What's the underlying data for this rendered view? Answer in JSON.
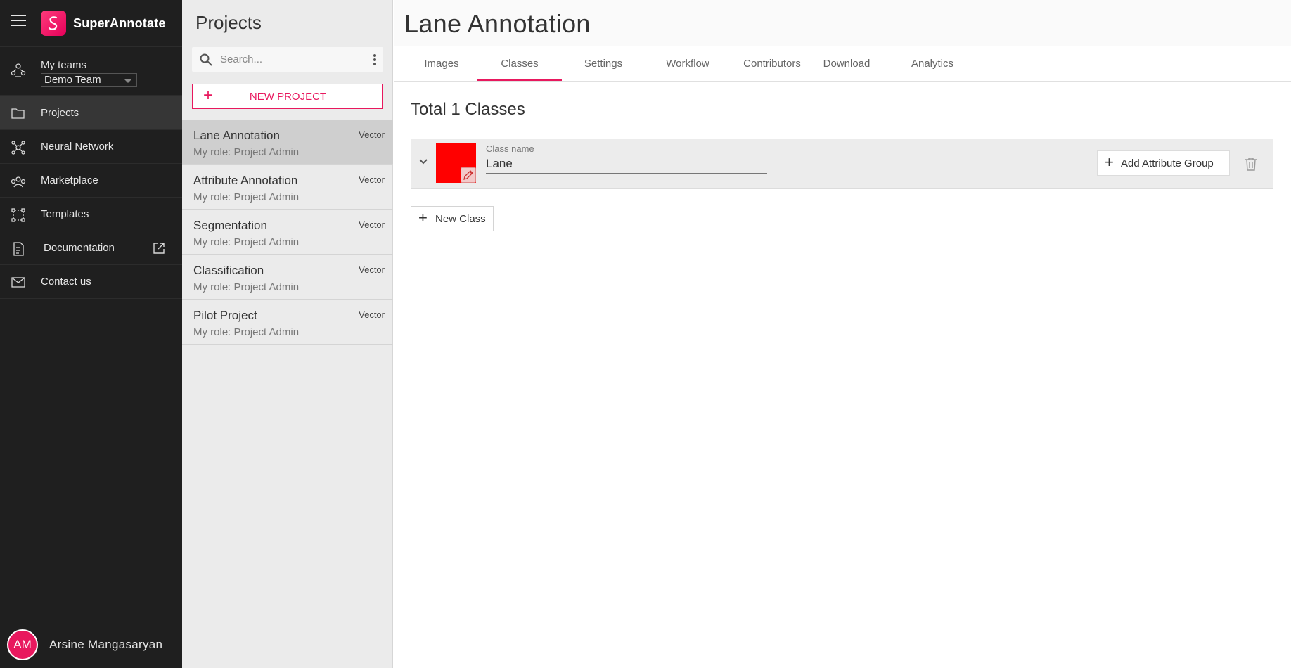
{
  "app": {
    "brand": "SuperAnnotate",
    "accent_color": "#e8185e"
  },
  "sidebar": {
    "teams_label": "My teams",
    "team_selected": "Demo Team",
    "items": [
      {
        "label": "Projects",
        "icon": "folder-icon",
        "active": true
      },
      {
        "label": "Neural Network",
        "icon": "neural-network-icon"
      },
      {
        "label": "Marketplace",
        "icon": "marketplace-icon"
      },
      {
        "label": "Templates",
        "icon": "templates-icon"
      },
      {
        "label": "Documentation",
        "icon": "document-icon"
      },
      {
        "label": "Contact us",
        "icon": "mail-icon"
      }
    ],
    "user": {
      "initials": "AM",
      "name": "Arsine Mangasaryan"
    }
  },
  "projects": {
    "title": "Projects",
    "search_placeholder": "Search...",
    "new_button": "NEW PROJECT",
    "list": [
      {
        "name": "Lane Annotation",
        "type": "Vector",
        "role": "My role: Project Admin",
        "active": true
      },
      {
        "name": "Attribute Annotation",
        "type": "Vector",
        "role": "My role: Project Admin"
      },
      {
        "name": "Segmentation",
        "type": "Vector",
        "role": "My role: Project Admin"
      },
      {
        "name": "Classification",
        "type": "Vector",
        "role": "My role: Project Admin"
      },
      {
        "name": "Pilot Project",
        "type": "Vector",
        "role": "My role: Project Admin"
      }
    ]
  },
  "main": {
    "title": "Lane Annotation",
    "tabs": [
      {
        "label": "Images"
      },
      {
        "label": "Classes",
        "active": true
      },
      {
        "label": "Settings"
      },
      {
        "label": "Workflow"
      },
      {
        "label": "Contributors"
      },
      {
        "label": "Download"
      },
      {
        "label": "Analytics"
      }
    ],
    "total_label": "Total 1 Classes",
    "classes": [
      {
        "name_label": "Class name",
        "name": "Lane",
        "color": "#ff0000"
      }
    ],
    "add_attribute_group": "Add Attribute Group",
    "new_class": "New Class"
  }
}
